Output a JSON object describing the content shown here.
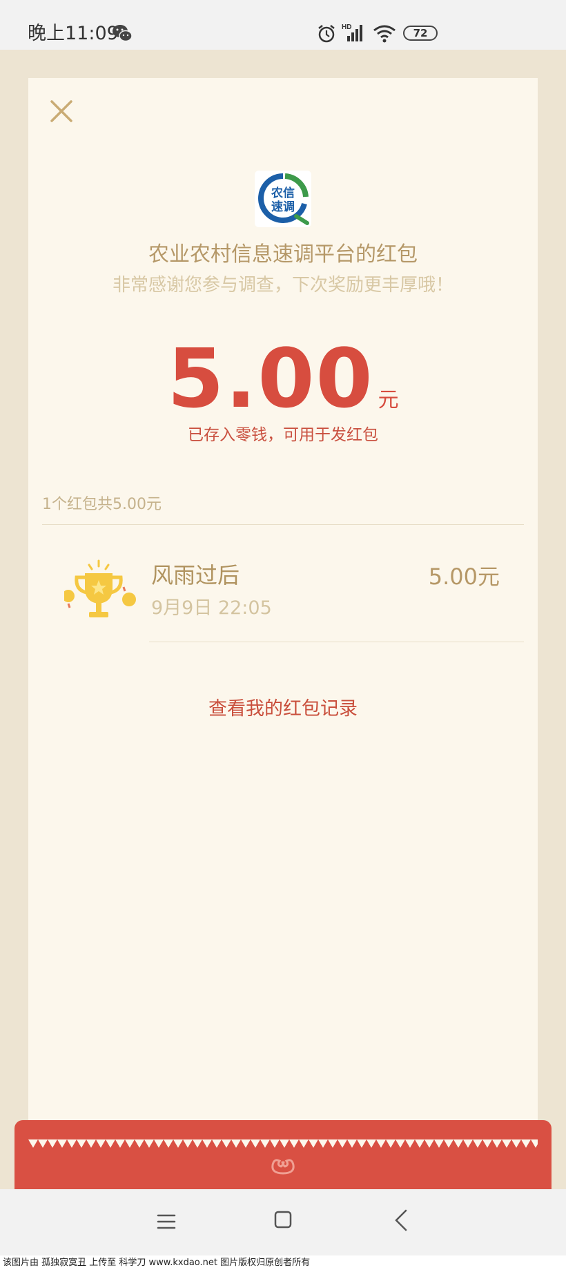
{
  "status_bar": {
    "time": "晚上11:09",
    "battery": "72",
    "network_label": "HD"
  },
  "red_packet": {
    "sender_title": "农业农村信息速调平台的红包",
    "sender_subtitle": "非常感谢您参与调查，下次奖励更丰厚哦！",
    "amount": "5.00",
    "amount_unit": "元",
    "amount_note": "已存入零钱，可用于发红包",
    "logo_text_line1": "农信",
    "logo_text_line2": "速调",
    "summary": "1个红包共5.00元",
    "records": [
      {
        "name": "风雨过后",
        "time": "9月9日  22:05",
        "amount": "5.00元"
      }
    ],
    "history_link": "查看我的红包记录"
  },
  "footer": {
    "watermark": "该图片由 孤独寂寞丑 上传至 科学刀 www.kxdao.net 图片版权归原创者所有"
  },
  "colors": {
    "accent_red": "#d74d3f",
    "gold_text": "#b59868",
    "card_bg": "#fcf7ec",
    "page_bg": "#ede4d2"
  }
}
